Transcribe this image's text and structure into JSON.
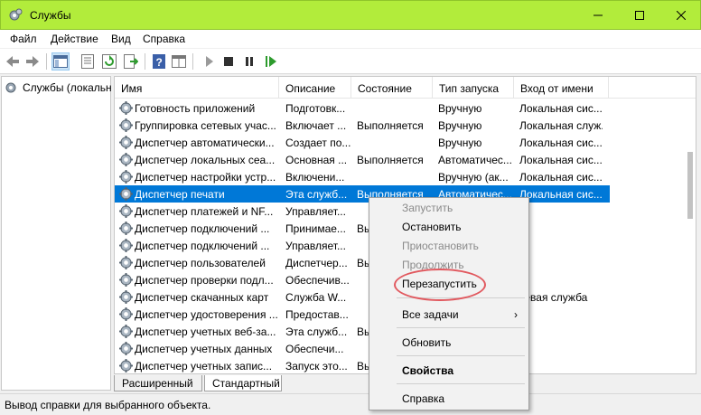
{
  "window": {
    "title": "Службы"
  },
  "menu": {
    "items": [
      "Файл",
      "Действие",
      "Вид",
      "Справка"
    ]
  },
  "tree": {
    "root_label": "Службы (локальны"
  },
  "columns": [
    "Имя",
    "Описание",
    "Состояние",
    "Тип запуска",
    "Вход от имени"
  ],
  "rows": [
    {
      "name": "Готовность приложений",
      "desc": "Подготовк...",
      "state": "",
      "start": "Вручную",
      "logon": "Локальная сис..."
    },
    {
      "name": "Группировка сетевых учас...",
      "desc": "Включает ...",
      "state": "Выполняется",
      "start": "Вручную",
      "logon": "Локальная служ..."
    },
    {
      "name": "Диспетчер автоматически...",
      "desc": "Создает по...",
      "state": "",
      "start": "Вручную",
      "logon": "Локальная сис..."
    },
    {
      "name": "Диспетчер локальных сеа...",
      "desc": "Основная ...",
      "state": "Выполняется",
      "start": "Автоматичес...",
      "logon": "Локальная сис..."
    },
    {
      "name": "Диспетчер настройки устр...",
      "desc": "Включени...",
      "state": "",
      "start": "Вручную (ак...",
      "logon": "Локальная сис..."
    },
    {
      "name": "Диспетчер печати",
      "desc": "Эта служб...",
      "state": "Выполняется",
      "start": "Автоматичес...",
      "logon": "Локальная сис..."
    },
    {
      "name": "Диспетчер платежей и NF...",
      "desc": "Управляет...",
      "state": "",
      "start": "",
      "logon": ""
    },
    {
      "name": "Диспетчер подключений ...",
      "desc": "Принимае...",
      "state": "Вы",
      "start": "",
      "logon": ""
    },
    {
      "name": "Диспетчер подключений ...",
      "desc": "Управляет...",
      "state": "",
      "start": "",
      "logon": ""
    },
    {
      "name": "Диспетчер пользователей",
      "desc": "Диспетчер...",
      "state": "Вы",
      "start": "",
      "logon": ""
    },
    {
      "name": "Диспетчер проверки подл...",
      "desc": "Обеспечив...",
      "state": "",
      "start": "",
      "logon": ""
    },
    {
      "name": "Диспетчер скачанных карт",
      "desc": "Служба W...",
      "state": "",
      "start": "",
      "logon": "тевая служба"
    },
    {
      "name": "Диспетчер удостоверения ...",
      "desc": "Предостав...",
      "state": "",
      "start": "",
      "logon": ""
    },
    {
      "name": "Диспетчер учетных веб-за...",
      "desc": "Эта служб...",
      "state": "Вы",
      "start": "",
      "logon": ""
    },
    {
      "name": "Диспетчер учетных данных",
      "desc": "Обеспечи...",
      "state": "",
      "start": "",
      "logon": ""
    },
    {
      "name": "Диспетчер учетных запис...",
      "desc": "Запуск это...",
      "state": "Вы",
      "start": "",
      "logon": ""
    }
  ],
  "selected_row_index": 5,
  "tabs": [
    "Расширенный",
    "Стандартный"
  ],
  "active_tab": "Стандартный",
  "status": "Вывод справки для выбранного объекта.",
  "context_menu": {
    "start": "Запустить",
    "stop": "Остановить",
    "pause": "Приостановить",
    "resume": "Продолжить",
    "restart": "Перезапустить",
    "all_tasks": "Все задачи",
    "refresh": "Обновить",
    "properties": "Свойства",
    "help": "Справка"
  },
  "colors": {
    "titlebar": "#b2ec3b",
    "selection": "#0078d7",
    "highlight": "#e1595f"
  }
}
